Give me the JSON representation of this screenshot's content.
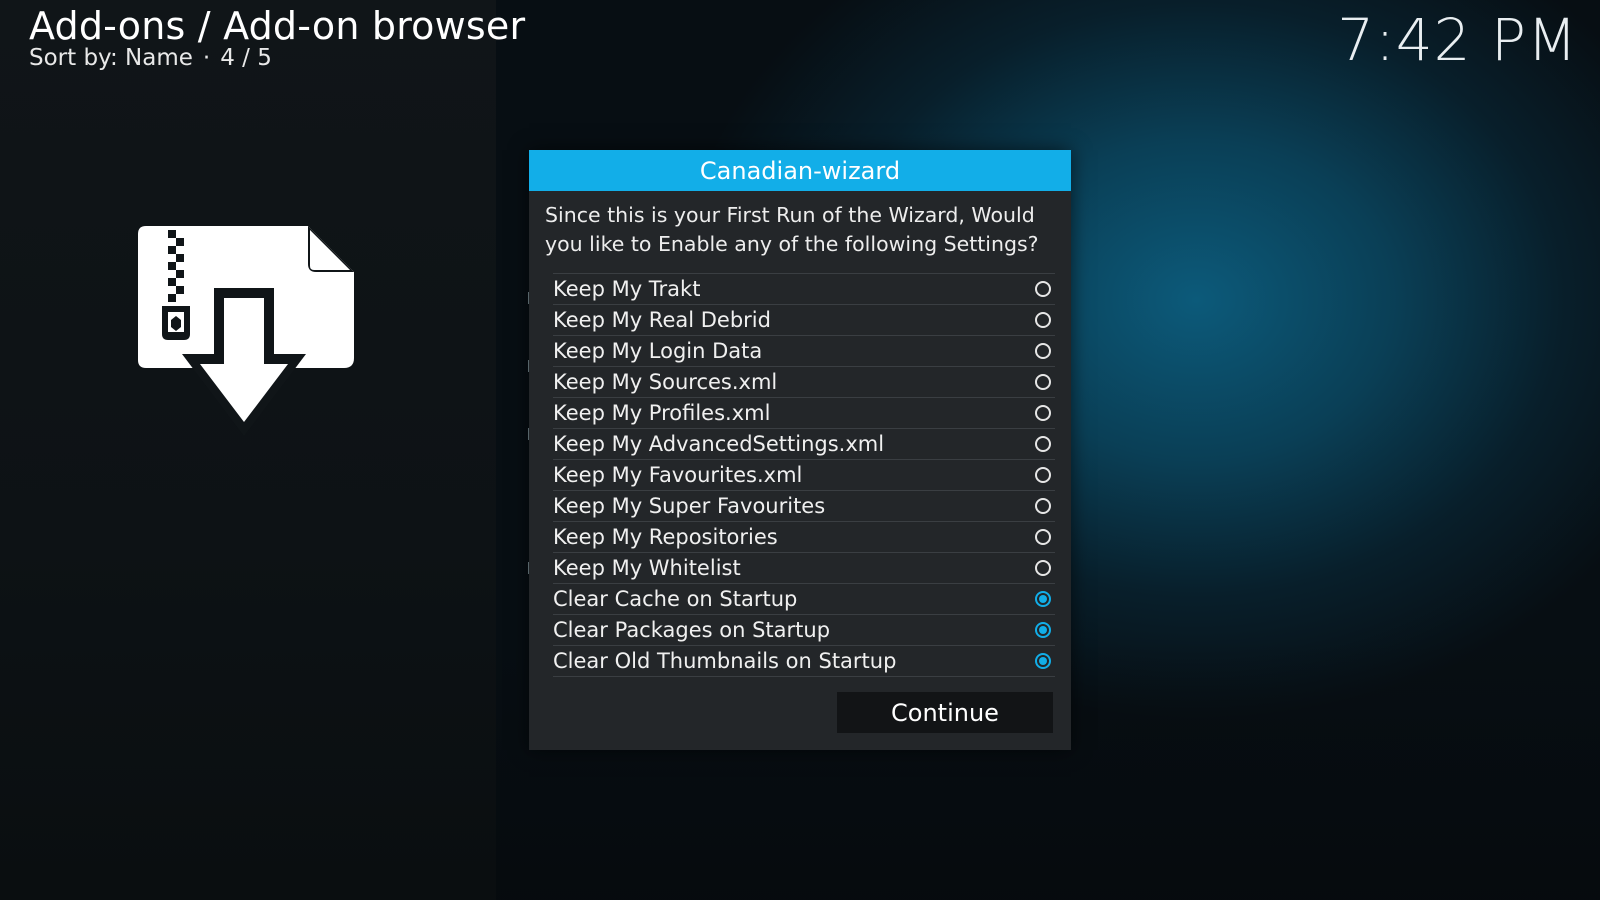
{
  "header": {
    "title": "Add-ons / Add-on browser",
    "sort_label": "Sort by: Name",
    "separator": "·",
    "position": "4 / 5"
  },
  "clock": "7:42 PM",
  "addon_icon": "zip-download-icon",
  "dialog": {
    "title": "Canadian-wizard",
    "message": "Since this is your First Run of the Wizard, Would you like to Enable any of the following Settings?",
    "options": [
      {
        "label": "Keep My Trakt",
        "checked": false
      },
      {
        "label": "Keep My Real Debrid",
        "checked": false
      },
      {
        "label": "Keep My Login Data",
        "checked": false
      },
      {
        "label": "Keep My Sources.xml",
        "checked": false
      },
      {
        "label": "Keep My Profiles.xml",
        "checked": false
      },
      {
        "label": "Keep My AdvancedSettings.xml",
        "checked": false
      },
      {
        "label": "Keep My Favourites.xml",
        "checked": false
      },
      {
        "label": "Keep My Super Favourites",
        "checked": false
      },
      {
        "label": "Keep My Repositories",
        "checked": false
      },
      {
        "label": "Keep My Whitelist",
        "checked": false
      },
      {
        "label": "Clear Cache on Startup",
        "checked": true
      },
      {
        "label": "Clear Packages on Startup",
        "checked": true
      },
      {
        "label": "Clear Old Thumbnails on Startup",
        "checked": true
      }
    ],
    "continue_label": "Continue"
  },
  "colors": {
    "accent": "#12aee8",
    "dialog_bg": "#232629",
    "button_bg": "#121416"
  }
}
